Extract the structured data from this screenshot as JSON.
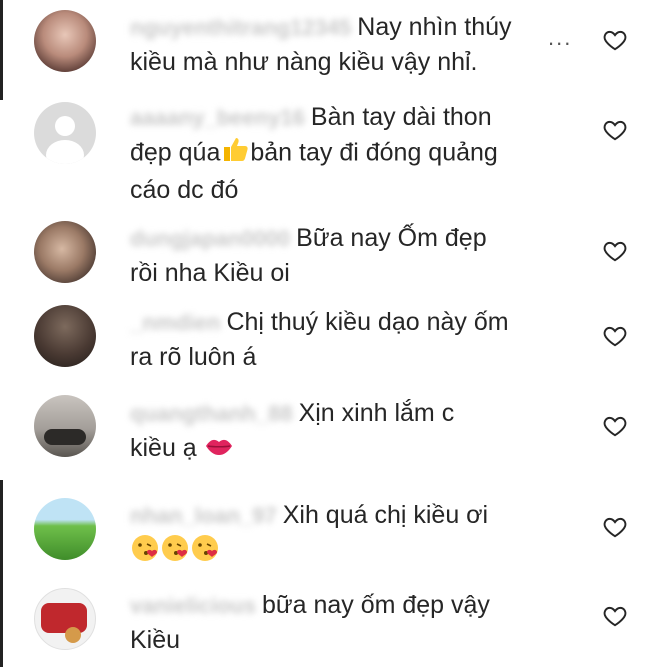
{
  "comments": [
    {
      "username": "nguyenthitrang12345",
      "text": "Nay nhìn thúy kiều mà như nàng kiều vậy nhỉ.",
      "line1": "Nay nhìn thúy",
      "line2": "kiều mà như nàng kiều vậy nhỉ."
    },
    {
      "username": "aaaany_beeny16",
      "line1": "Bàn tay dài thon",
      "line2": "đẹp qúa",
      "line2b": "bản tay đi đóng quảng",
      "line3": "cáo dc đó"
    },
    {
      "username": "dungjapan0000",
      "line1": "Bữa nay Ốm đẹp",
      "line2": "rồi nha Kiều oi"
    },
    {
      "username": "_nmdien",
      "line1": "Chị thuý kiều dạo này ốm",
      "line2": "ra rõ luôn á"
    },
    {
      "username": "quangthanh_88",
      "line1": "Xịn xinh lắm c",
      "line2": "kiều ạ"
    },
    {
      "username": "nhan_loan_97",
      "line1": "Xih quá chị kiều ơi"
    },
    {
      "username": "vanielicious",
      "line1": "bữa nay ốm đẹp vậy",
      "line2": "Kiều"
    }
  ],
  "more_label": "...",
  "icons": {
    "heart": "heart-outline-icon",
    "thumbs_up": "thumbs-up-emoji",
    "kiss_lips": "kiss-lips-emoji",
    "kiss_face": "kissing-face-emoji"
  }
}
